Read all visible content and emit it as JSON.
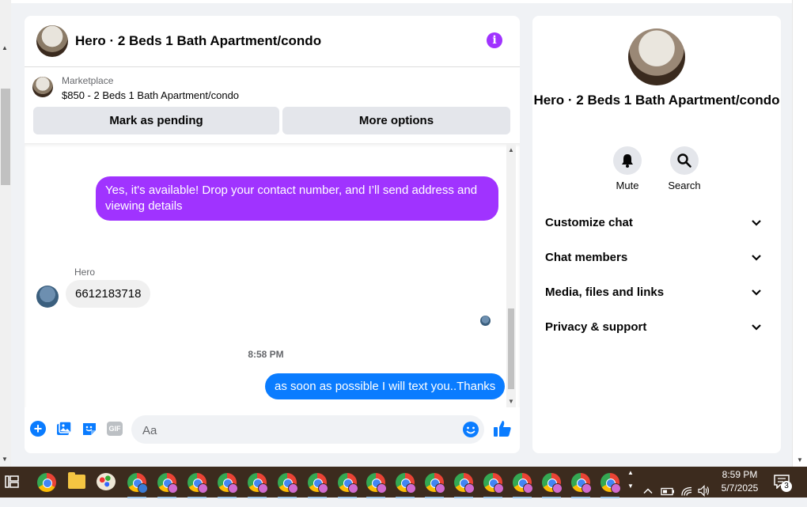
{
  "chat": {
    "title": "Hero · 2 Beds 1 Bath Apartment/condo",
    "marketplace_label": "Marketplace",
    "marketplace_desc": "$850 - 2 Beds 1 Bath Apartment/condo",
    "pending_label": "Mark as pending",
    "more_label": "More options",
    "messages": {
      "out1": "Yes, it's available! Drop your contact number, and I’ll send address and viewing details",
      "sender": "Hero",
      "in1": "6612183718",
      "time": "8:58 PM",
      "out2": "as soon as possible I will text you..Thanks"
    },
    "composer": {
      "placeholder": "Aa",
      "gif": "GIF"
    }
  },
  "info": {
    "title": "Hero · 2 Beds 1 Bath Apartment/condo",
    "mute_label": "Mute",
    "search_label": "Search",
    "sections": [
      "Customize chat",
      "Chat members",
      "Media, files and links",
      "Privacy & support"
    ]
  },
  "taskbar": {
    "time": "8:59 PM",
    "date": "5/7/2025",
    "notifications": "3"
  },
  "colors": {
    "outgoing_purple": "#a033ff",
    "outgoing_blue": "#0a7cff",
    "accent": "#0a7cff"
  }
}
